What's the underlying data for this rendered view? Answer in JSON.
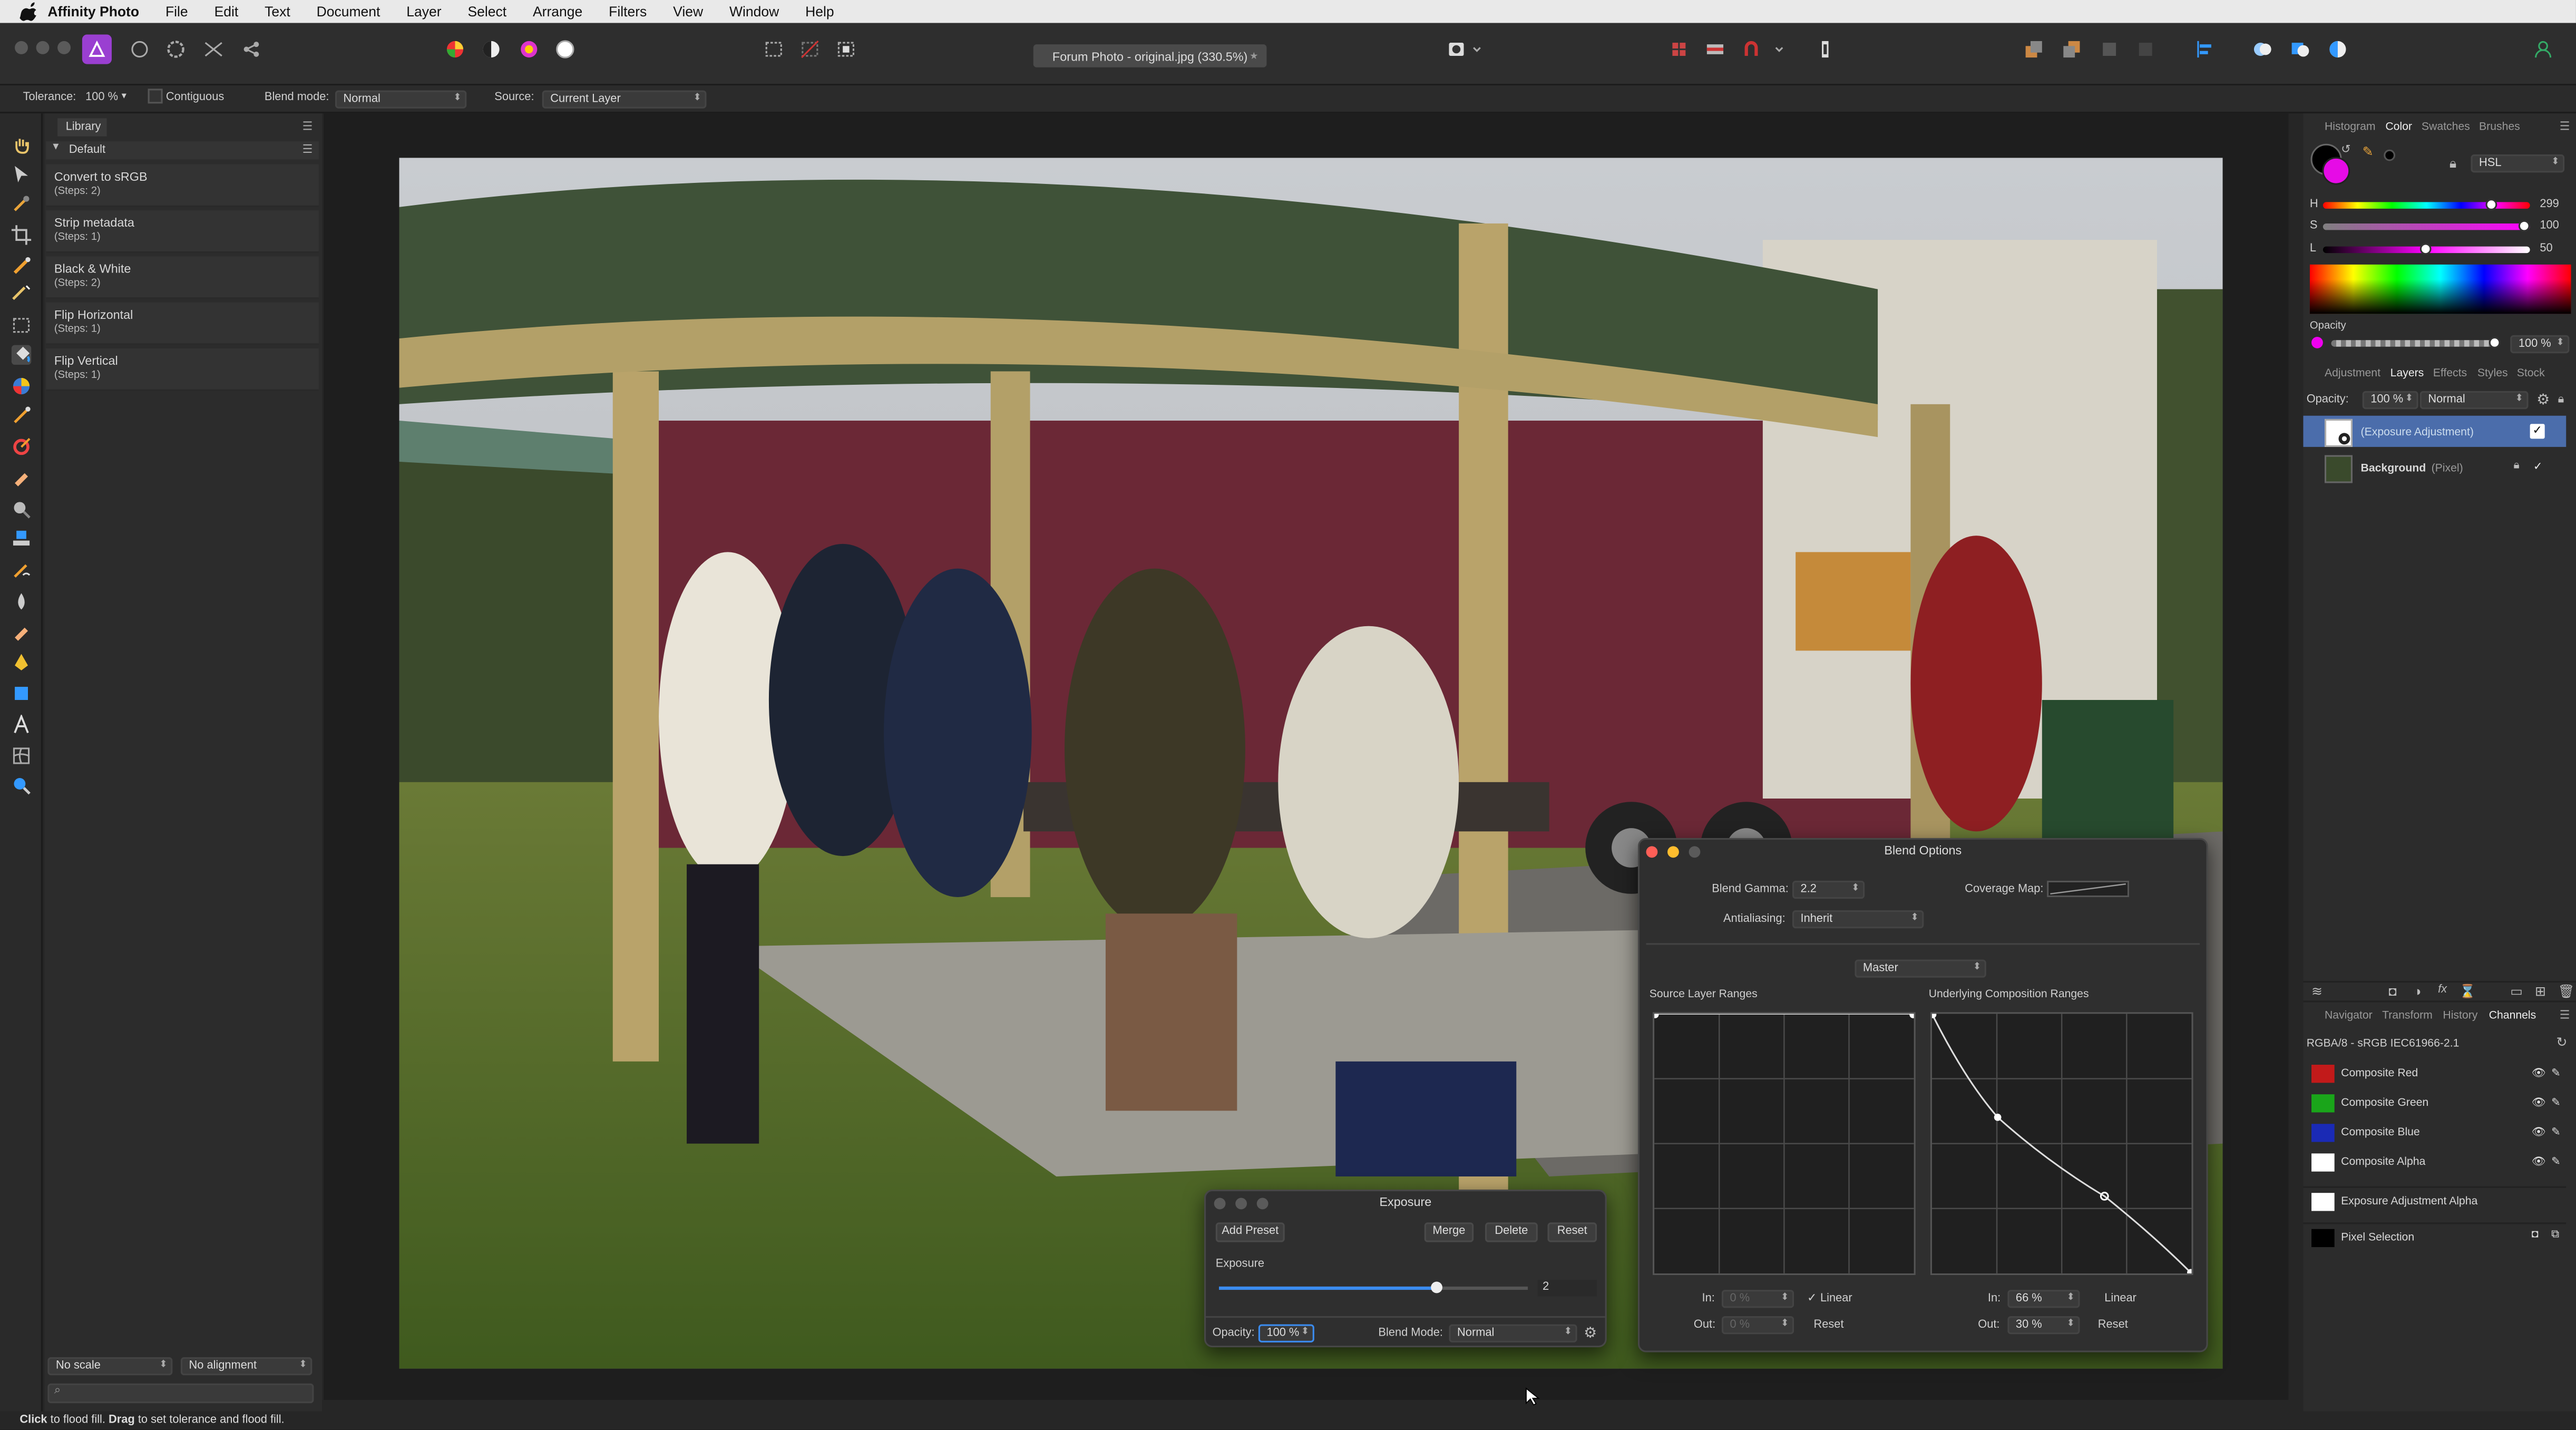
{
  "menubar": {
    "app": "Affinity Photo",
    "items": [
      "File",
      "Edit",
      "Text",
      "Document",
      "Layer",
      "Select",
      "Arrange",
      "Filters",
      "View",
      "Window",
      "Help"
    ]
  },
  "toolbar": {
    "doc_tab": "Forum Photo - original.jpg (330.5%)",
    "doc_tab_star": "★"
  },
  "context": {
    "tolerance_label": "Tolerance:",
    "tolerance_value": "100 %",
    "contiguous": "Contiguous",
    "blend_label": "Blend mode:",
    "blend_value": "Normal",
    "source_label": "Source:",
    "source_value": "Current Layer"
  },
  "library": {
    "tab": "Library",
    "group": "Default",
    "items": [
      {
        "name": "Convert to sRGB",
        "steps": "(Steps: 2)"
      },
      {
        "name": "Strip metadata",
        "steps": "(Steps: 1)"
      },
      {
        "name": "Black & White",
        "steps": "(Steps: 2)"
      },
      {
        "name": "Flip Horizontal",
        "steps": "(Steps: 1)"
      },
      {
        "name": "Flip Vertical",
        "steps": "(Steps: 1)"
      }
    ],
    "scale": "No scale",
    "alignment": "No alignment"
  },
  "status": {
    "click": "Click",
    "text1": " to flood fill. ",
    "drag": "Drag",
    "text2": " to set tolerance and flood fill."
  },
  "color_panel": {
    "tabs": [
      "Histogram",
      "Color",
      "Swatches",
      "Brushes"
    ],
    "mode": "HSL",
    "h_label": "H",
    "h": "299",
    "s_label": "S",
    "s": "100",
    "l_label": "L",
    "l": "50",
    "opacity_label": "Opacity",
    "opacity": "100 %",
    "current_color": "#e60be6"
  },
  "layers_panel": {
    "tabs": [
      "Adjustment",
      "Layers",
      "Effects",
      "Styles",
      "Stock"
    ],
    "opacity_label": "Opacity:",
    "opacity": "100 %",
    "blend": "Normal",
    "layers": [
      {
        "name": "(Exposure Adjustment)"
      },
      {
        "name": "Background",
        "kind": "(Pixel)"
      }
    ]
  },
  "channels_panel": {
    "tabs": [
      "Navigator",
      "Transform",
      "History",
      "Channels"
    ],
    "header": "RGBA/8 - sRGB IEC61966-2.1",
    "channels": [
      "Composite Red",
      "Composite Green",
      "Composite Blue",
      "Composite Alpha",
      "Exposure Adjustment Alpha",
      "Pixel Selection"
    ],
    "colors": [
      "#c21a1a",
      "#1aa51a",
      "#1a2ab5",
      "#ffffff",
      "#ffffff",
      "#000000"
    ]
  },
  "blend_options": {
    "title": "Blend Options",
    "gamma_label": "Blend Gamma:",
    "gamma": "2.2",
    "coverage_label": "Coverage Map:",
    "aa_label": "Antialiasing:",
    "aa": "Inherit",
    "channel": "Master",
    "source_ranges": "Source Layer Ranges",
    "underlying_ranges": "Underlying Composition Ranges",
    "src_in_label": "In:",
    "src_in": "0 %",
    "src_out_label": "Out:",
    "src_out": "0 %",
    "src_linear": "Linear",
    "src_reset": "Reset",
    "und_in_label": "In:",
    "und_in": "66 %",
    "und_out_label": "Out:",
    "und_out": "30 %",
    "und_linear": "Linear",
    "und_reset": "Reset"
  },
  "exposure": {
    "title": "Exposure",
    "add_preset": "Add Preset",
    "merge": "Merge",
    "delete": "Delete",
    "reset": "Reset",
    "exposure_label": "Exposure",
    "exposure_value": "2",
    "exposure_level": 0.7,
    "opacity_label": "Opacity:",
    "opacity": "100 %",
    "blend_label": "Blend Mode:",
    "blend": "Normal"
  }
}
